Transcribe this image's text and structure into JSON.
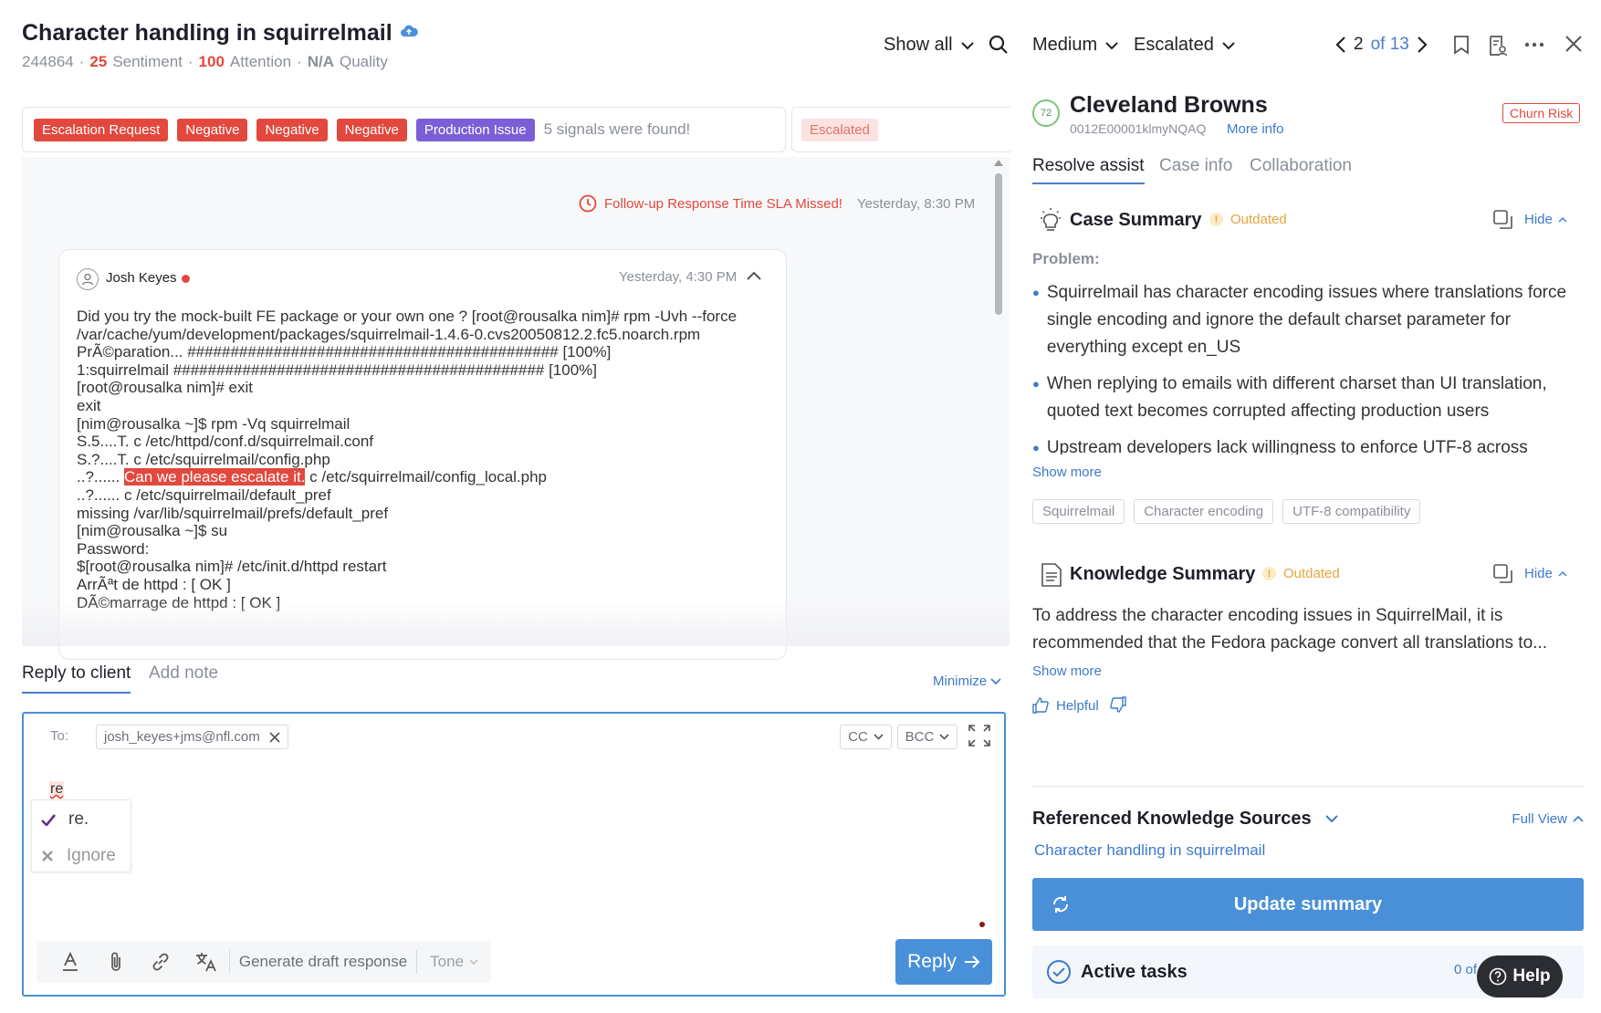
{
  "ticket": {
    "title": "Character handling in squirrelmail",
    "id": "244864",
    "sentiment_value": "25",
    "sentiment_label": "Sentiment",
    "attention_value": "100",
    "attention_label": "Attention",
    "quality_value": "N/A",
    "quality_label": "Quality"
  },
  "toolbar": {
    "show_all": "Show all"
  },
  "signals": {
    "tags": [
      "Escalation Request",
      "Negative",
      "Negative",
      "Negative",
      "Production Issue"
    ],
    "summary": "5 signals were found!",
    "status": "Escalated"
  },
  "conversation": {
    "sla_text": "Follow-up Response Time SLA Missed!",
    "sla_time": "Yesterday, 8:30 PM",
    "message": {
      "author": "Josh Keyes",
      "time": "Yesterday, 4:30 PM",
      "lines": [
        "Did you try the mock-built FE package or your own one ? [root@rousalka nim]# rpm -Uvh --force",
        "/var/cache/yum/development/packages/squirrelmail-1.4.6-0.cvs20050812.2.fc5.noarch.rpm",
        "PrÃ©paration... ########################################### [100%]",
        "1:squirrelmail ########################################### [100%]",
        "[root@rousalka nim]# exit",
        "exit",
        "[nim@rousalka ~]$ rpm -Vq squirrelmail",
        "S.5....T. c /etc/httpd/conf.d/squirrelmail.conf",
        "S.?....T. c /etc/squirrelmail/config.php"
      ],
      "highlight_prefix": "..?......",
      "highlight_text": "Can we please escalate it.",
      "highlight_suffix": " c /etc/squirrelmail/config_local.php",
      "lines_after": [
        "..?...... c /etc/squirrelmail/default_pref",
        "missing /var/lib/squirrelmail/prefs/default_pref",
        "[nim@rousalka ~]$ su",
        "Password:",
        "$[root@rousalka nim]# /etc/init.d/httpd restart",
        "ArrÃªt de httpd : [ OK ]",
        "DÃ©marrage de httpd : [ OK ]"
      ]
    }
  },
  "reply": {
    "tab_reply": "Reply to client",
    "tab_note": "Add note",
    "minimize": "Minimize",
    "to_label": "To:",
    "to_value": "josh_keyes+jms@nfl.com",
    "cc": "CC",
    "bcc": "BCC",
    "typed": "re",
    "suggestion_accept": "re.",
    "suggestion_ignore": "Ignore",
    "generate": "Generate draft response",
    "tone": "Tone",
    "send": "Reply"
  },
  "right": {
    "priority": "Medium",
    "state": "Escalated",
    "page_current": "2",
    "page_of": "of 13",
    "score": "72",
    "account_name": "Cleveland Browns",
    "account_id": "0012E00001klmyNQAQ",
    "more_info": "More info",
    "churn": "Churn Risk",
    "tabs": [
      "Resolve assist",
      "Case info",
      "Collaboration"
    ],
    "case_summary": {
      "title": "Case Summary",
      "badge": "Outdated",
      "hide": "Hide",
      "problem_label": "Problem:",
      "bullets": [
        "Squirrelmail has character encoding issues where translations force single encoding and ignore the default charset parameter for everything except en_US",
        "When replying to emails with different charset than UI translation, quoted text becomes corrupted affecting production users",
        "Upstream developers lack willingness to enforce UTF-8 across"
      ],
      "show_more": "Show more",
      "chips": [
        "Squirrelmail",
        "Character encoding",
        "UTF-8 compatibility"
      ]
    },
    "knowledge_summary": {
      "title": "Knowledge Summary",
      "badge": "Outdated",
      "hide": "Hide",
      "text": "To address the character encoding issues in SquirrelMail, it is recommended that the Fedora package convert all translations to...",
      "show_more": "Show more",
      "helpful": "Helpful"
    },
    "ref_sources": {
      "title": "Referenced Knowledge Sources",
      "full_view": "Full View",
      "link": "Character handling in squirrelmail"
    },
    "update_button": "Update summary",
    "active_tasks": "Active tasks",
    "active_tasks_count": "0 of",
    "help": "Help"
  },
  "colors": {
    "accent": "#4a90d9",
    "danger": "#e2483d",
    "warning": "#e8a33d",
    "purple": "#7b5fd6"
  }
}
